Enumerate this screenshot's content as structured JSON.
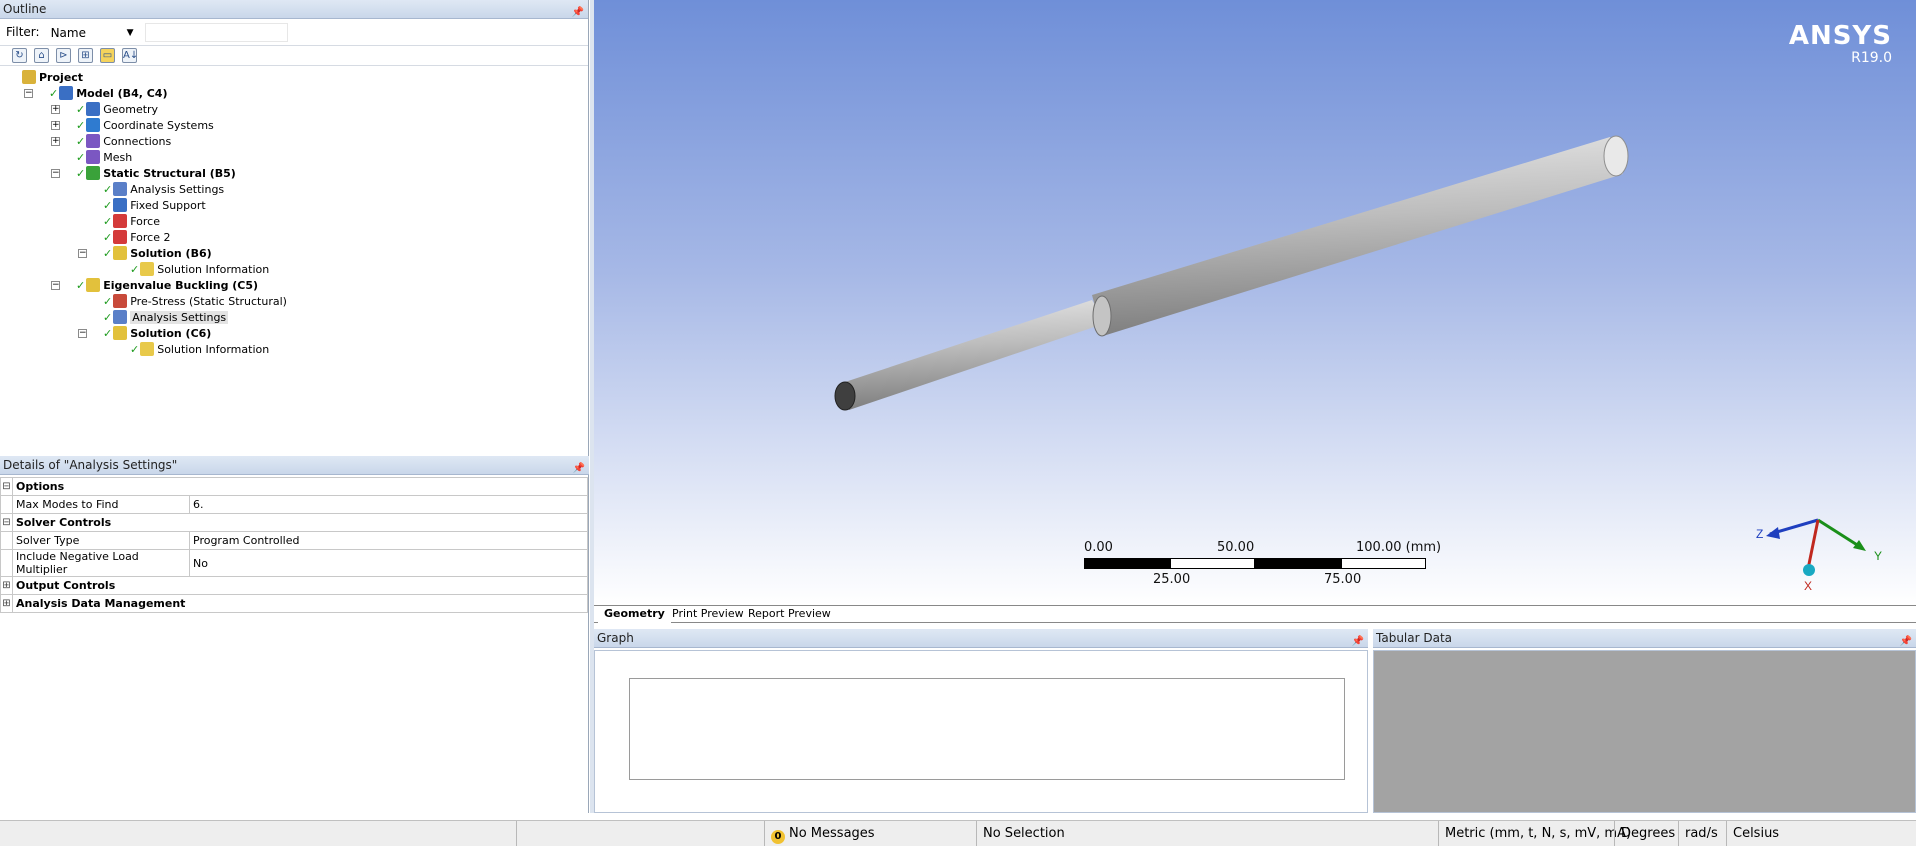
{
  "outline": {
    "title": "Outline",
    "filter_label": "Filter:",
    "filter_value": "Name",
    "tree": [
      {
        "label": "Project",
        "bold": true,
        "icon": "project-icon"
      },
      {
        "label": "Model (B4, C4)",
        "bold": true,
        "icon": "model-icon"
      },
      {
        "label": "Geometry",
        "icon": "geometry-icon"
      },
      {
        "label": "Coordinate Systems",
        "icon": "coordinate-systems-icon"
      },
      {
        "label": "Connections",
        "icon": "connections-icon"
      },
      {
        "label": "Mesh",
        "icon": "mesh-icon"
      },
      {
        "label": "Static Structural (B5)",
        "bold": true,
        "icon": "static-structural-icon"
      },
      {
        "label": "Analysis Settings",
        "icon": "analysis-settings-icon"
      },
      {
        "label": "Fixed Support",
        "icon": "fixed-support-icon"
      },
      {
        "label": "Force",
        "icon": "force-icon"
      },
      {
        "label": "Force 2",
        "icon": "force-icon"
      },
      {
        "label": "Solution (B6)",
        "bold": true,
        "icon": "solution-icon"
      },
      {
        "label": "Solution Information",
        "icon": "solution-information-icon"
      },
      {
        "label": "Eigenvalue Buckling (C5)",
        "bold": true,
        "icon": "eigenvalue-buckling-icon"
      },
      {
        "label": "Pre-Stress (Static Structural)",
        "icon": "pre-stress-icon"
      },
      {
        "label": "Analysis Settings",
        "icon": "analysis-settings-icon",
        "selected": true
      },
      {
        "label": "Solution (C6)",
        "bold": true,
        "icon": "solution-icon"
      },
      {
        "label": "Solution Information",
        "icon": "solution-information-icon"
      }
    ]
  },
  "details": {
    "title": "Details of \"Analysis Settings\"",
    "rows": [
      {
        "group": true,
        "toggle": "⊟",
        "name": "Options"
      },
      {
        "name": "Max Modes to Find",
        "value": "6."
      },
      {
        "group": true,
        "toggle": "⊟",
        "name": "Solver Controls"
      },
      {
        "name": "Solver Type",
        "value": "Program Controlled"
      },
      {
        "name": "Include Negative Load Multiplier",
        "value": "No"
      },
      {
        "group": true,
        "toggle": "⊞",
        "name": "Output Controls"
      },
      {
        "group": true,
        "toggle": "⊞",
        "name": "Analysis Data Management"
      }
    ]
  },
  "viewport": {
    "brand": "ANSYS",
    "version": "R19.0",
    "scale_labels_top": [
      "0.00",
      "50.00",
      "100.00 (mm)"
    ],
    "scale_labels_bottom": [
      "25.00",
      "75.00"
    ],
    "axes": {
      "z": "Z",
      "y": "Y",
      "x": "X"
    },
    "colors": {
      "bg_top": "#6f8fd8",
      "bg_bottom": "#ffffff",
      "shaft": "#bfbfbf"
    }
  },
  "tabs": [
    "Geometry",
    "Print Preview",
    "Report Preview"
  ],
  "graph": {
    "title": "Graph"
  },
  "tabular": {
    "title": "Tabular Data"
  },
  "status": {
    "messages_count": "0",
    "messages": "No Messages",
    "selection": "No Selection",
    "units": "Metric (mm, t, N, s, mV, mA)",
    "angle": "Degrees",
    "rate": "rad/s",
    "temperature": "Celsius"
  }
}
